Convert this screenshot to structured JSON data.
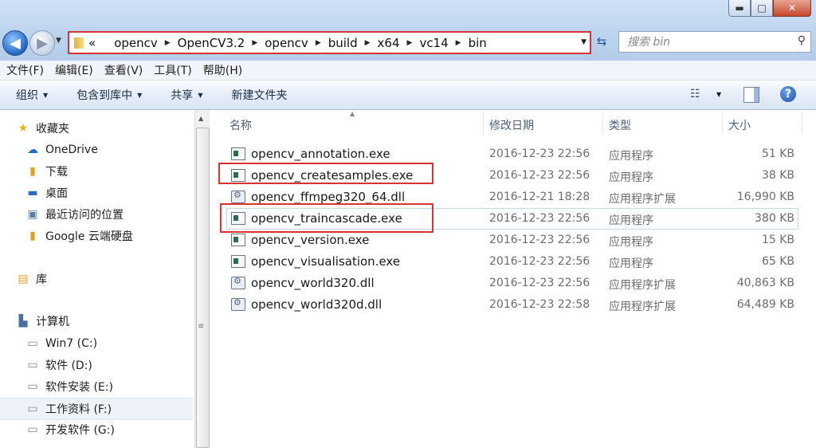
{
  "window": {
    "minimize": "▬",
    "maximize": "□",
    "close": "✕"
  },
  "nav": {
    "back": "◀",
    "forward": "▶"
  },
  "address": {
    "overflow": "«",
    "crumbs": [
      "opencv",
      "OpenCV3.2",
      "opencv",
      "build",
      "x64",
      "vc14",
      "bin"
    ]
  },
  "search": {
    "placeholder": "搜索 bin"
  },
  "menubar": [
    "文件(F)",
    "编辑(E)",
    "查看(V)",
    "工具(T)",
    "帮助(H)"
  ],
  "toolbar": {
    "organize": "组织",
    "include_library": "包含到库中",
    "share": "共享",
    "new_folder": "新建文件夹"
  },
  "sidebar": {
    "favorites_header": "收藏夹",
    "favorites": [
      "OneDrive",
      "下载",
      "桌面",
      "最近访问的位置",
      "Google 云端硬盘"
    ],
    "libraries": "库",
    "computer": "计算机",
    "drives": [
      "Win7 (C:)",
      "软件 (D:)",
      "软件安装 (E:)",
      "工作资料 (F:)",
      "开发软件 (G:)"
    ]
  },
  "columns": {
    "name": "名称",
    "modified": "修改日期",
    "type": "类型",
    "size": "大小"
  },
  "files": [
    {
      "name": "opencv_annotation.exe",
      "date": "2016-12-23 22:56",
      "type": "应用程序",
      "size": "51 KB",
      "kind": "exe"
    },
    {
      "name": "opencv_createsamples.exe",
      "date": "2016-12-23 22:56",
      "type": "应用程序",
      "size": "38 KB",
      "kind": "exe"
    },
    {
      "name": "opencv_ffmpeg320_64.dll",
      "date": "2016-12-21 18:28",
      "type": "应用程序扩展",
      "size": "16,990 KB",
      "kind": "dll"
    },
    {
      "name": "opencv_traincascade.exe",
      "date": "2016-12-23 22:56",
      "type": "应用程序",
      "size": "380 KB",
      "kind": "exe"
    },
    {
      "name": "opencv_version.exe",
      "date": "2016-12-23 22:56",
      "type": "应用程序",
      "size": "15 KB",
      "kind": "exe"
    },
    {
      "name": "opencv_visualisation.exe",
      "date": "2016-12-23 22:56",
      "type": "应用程序",
      "size": "65 KB",
      "kind": "exe"
    },
    {
      "name": "opencv_world320.dll",
      "date": "2016-12-23 22:56",
      "type": "应用程序扩展",
      "size": "40,863 KB",
      "kind": "dll"
    },
    {
      "name": "opencv_world320d.dll",
      "date": "2016-12-23 22:58",
      "type": "应用程序扩展",
      "size": "64,489 KB",
      "kind": "dll"
    }
  ]
}
